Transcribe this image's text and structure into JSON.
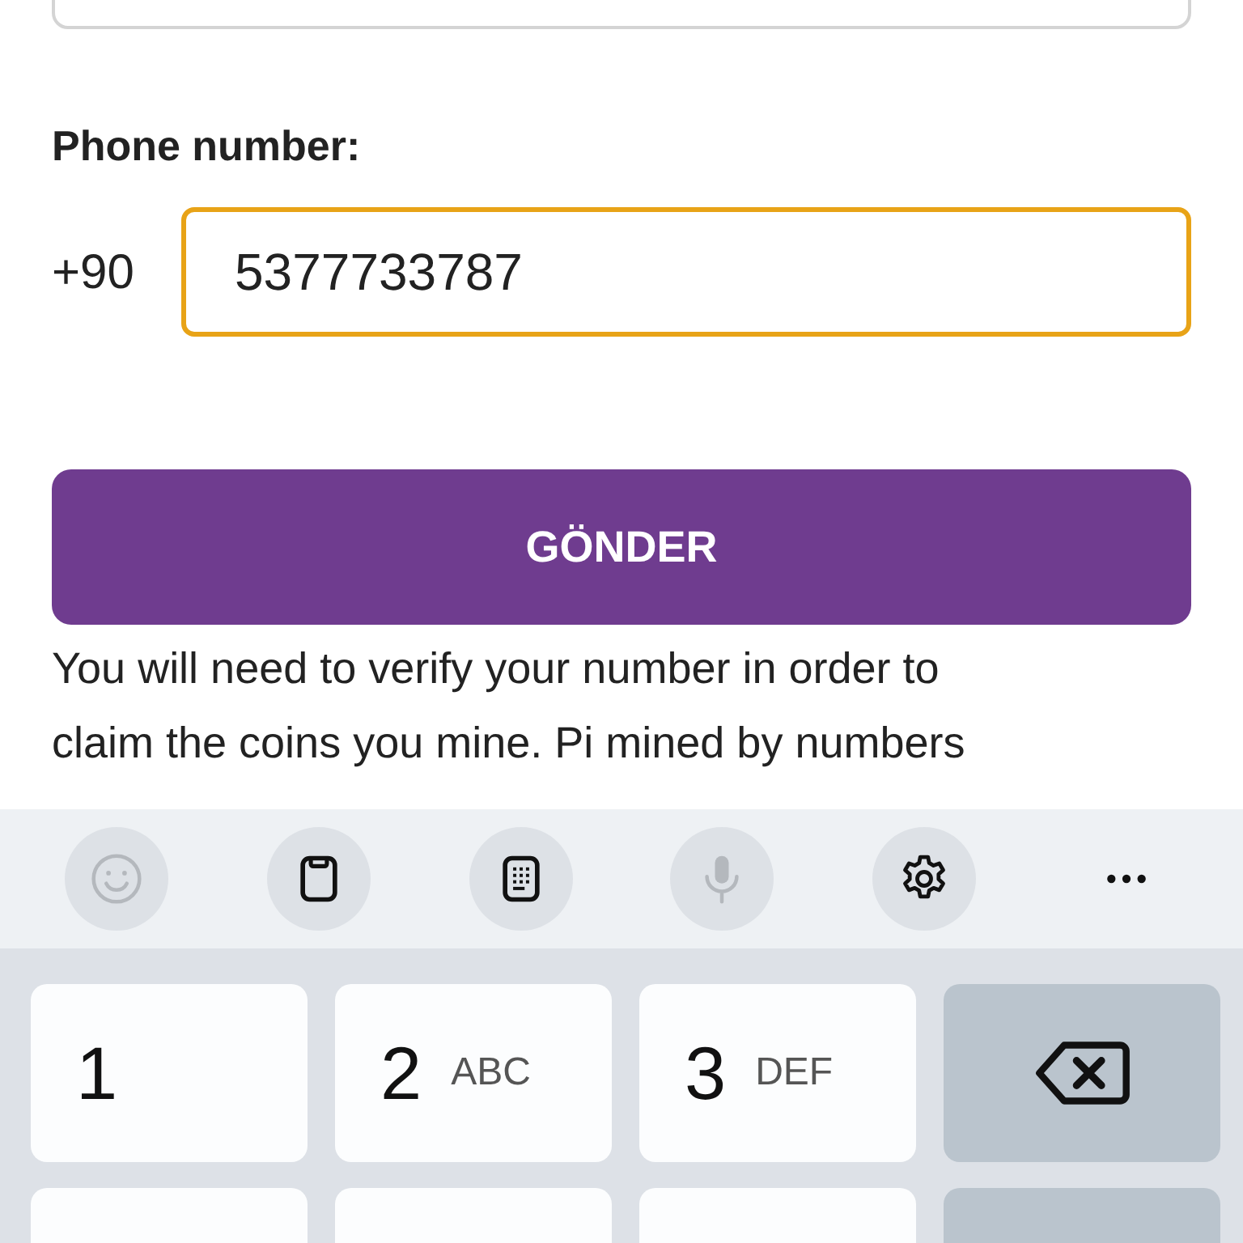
{
  "phone": {
    "label": "Phone number:",
    "country_code": "+90",
    "value": "5377733787",
    "focused": true
  },
  "submit_button": "GÖNDER",
  "note": [
    "You will need to verify your number in order to",
    "claim the coins you mine. Pi mined by numbers"
  ],
  "keyboard": {
    "toolbar": [
      {
        "kind": "emoji",
        "disabled": true
      },
      {
        "kind": "clipboard",
        "disabled": false
      },
      {
        "kind": "keypad",
        "disabled": false
      },
      {
        "kind": "mic",
        "disabled": true
      },
      {
        "kind": "settings",
        "disabled": false
      },
      {
        "kind": "more",
        "disabled": false
      }
    ],
    "rows": [
      [
        {
          "kind": "digit",
          "label": "1"
        },
        {
          "kind": "digit",
          "label": "2",
          "letters": "ABC"
        },
        {
          "kind": "digit",
          "label": "3",
          "letters": "DEF"
        },
        {
          "kind": "backspace"
        }
      ],
      [
        {
          "kind": "digit"
        },
        {
          "kind": "digit"
        },
        {
          "kind": "digit"
        },
        {
          "kind": "action"
        }
      ]
    ]
  }
}
